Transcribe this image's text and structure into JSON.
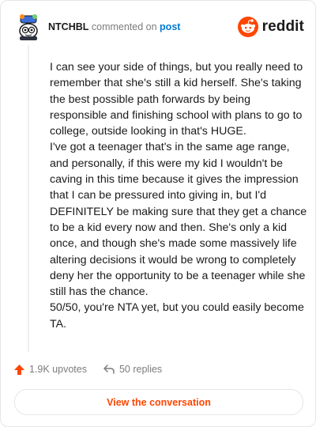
{
  "header": {
    "username": "NTCHBL",
    "action_text": "commented on",
    "post_link": "post",
    "brand": "reddit"
  },
  "comment": {
    "paragraphs": [
      "I can see your side of things, but you really need to remember that she's still a kid herself. She's taking the best possible path forwards by being responsible and finishing school with plans to go to college, outside looking in that's HUGE.",
      "I've got a teenager that's in the same age range, and personally, if this were my kid I wouldn't be caving in this time because it gives the impression that I can be pressured into giving in, but I'd DEFINITELY be making sure that they get a chance to be a kid every now and then. She's only a kid once, and though she's made some massively life altering decisions it would be wrong to completely deny her the opportunity to be a teenager while she still has the chance.",
      "50/50, you're NTA yet, but you could easily become TA."
    ]
  },
  "actions": {
    "upvotes": "1.9K upvotes",
    "replies": "50 replies"
  },
  "footer": {
    "button_label": "View the conversation"
  },
  "icons": {
    "upvote": "upvote-arrow-icon",
    "reply": "reply-arrow-icon",
    "brand": "reddit-snoo-icon"
  },
  "colors": {
    "accent": "#ff4500",
    "link": "#0079d3",
    "text": "#1a1a1b",
    "muted": "#7c7c7c",
    "border": "#e4e6e8"
  }
}
